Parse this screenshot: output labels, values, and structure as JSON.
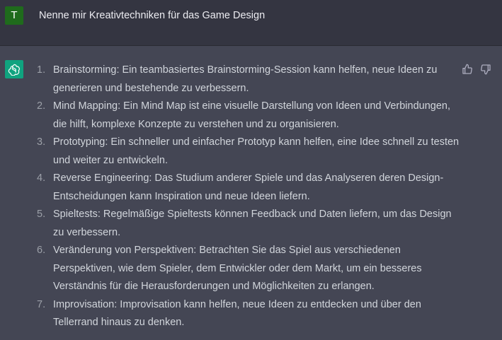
{
  "user_message": {
    "avatar_letter": "T",
    "text": "Nenne mir Kreativtechniken für das Game Design"
  },
  "assistant_message": {
    "items": [
      {
        "number": "1.",
        "text": "Brainstorming: Ein teambasiertes Brainstorming-Session kann helfen, neue Ideen zu generieren und bestehende zu verbessern."
      },
      {
        "number": "2.",
        "text": "Mind Mapping: Ein Mind Map ist eine visuelle Darstellung von Ideen und Verbindungen, die hilft, komplexe Konzepte zu verstehen und zu organisieren."
      },
      {
        "number": "3.",
        "text": "Prototyping: Ein schneller und einfacher Prototyp kann helfen, eine Idee schnell zu testen und weiter zu entwickeln."
      },
      {
        "number": "4.",
        "text": "Reverse Engineering: Das Studium anderer Spiele und das Analyseren deren Design-Entscheidungen kann Inspiration und neue Ideen liefern."
      },
      {
        "number": "5.",
        "text": "Spieltests: Regelmäßige Spieltests können Feedback und Daten liefern, um das Design zu verbessern."
      },
      {
        "number": "6.",
        "text": "Veränderung von Perspektiven: Betrachten Sie das Spiel aus verschiedenen Perspektiven, wie dem Spieler, dem Entwickler oder dem Markt, um ein besseres Verständnis für die Herausforderungen und Möglichkeiten zu erlangen."
      },
      {
        "number": "7.",
        "text": "Improvisation: Improvisation kann helfen, neue Ideen zu entdecken und über den Tellerrand hinaus zu denken."
      }
    ]
  },
  "icons": {
    "assistant_avatar": "openai-logo-icon",
    "thumbs_up": "thumbs-up-icon",
    "thumbs_down": "thumbs-down-icon"
  },
  "colors": {
    "user_bg": "#343541",
    "assistant_bg": "#444654",
    "user_avatar": "#1f6b1c",
    "assistant_avatar": "#10a37f"
  }
}
